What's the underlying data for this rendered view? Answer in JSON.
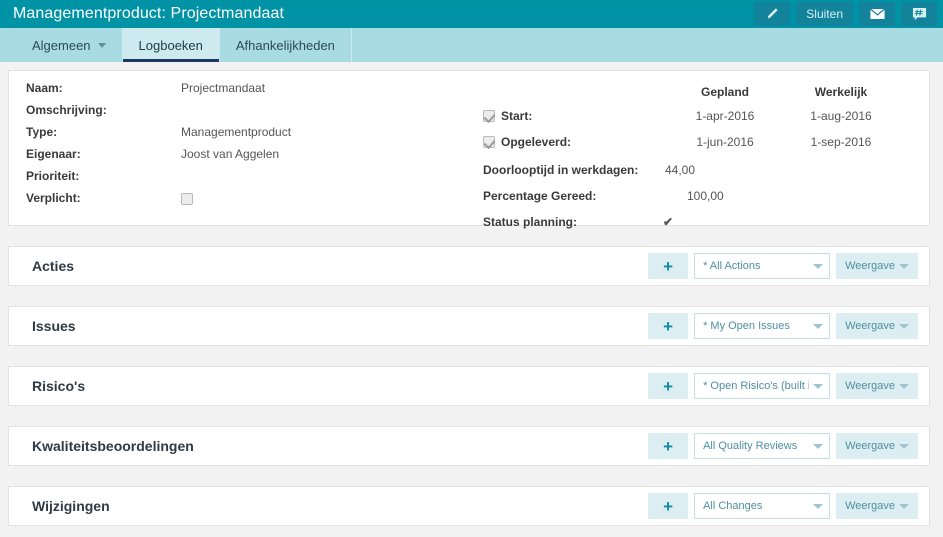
{
  "header": {
    "title": "Managementproduct: Projectmandaat",
    "actions": [
      {
        "name": "edit-button",
        "label": "",
        "icon": "pencil-icon"
      },
      {
        "name": "close-button",
        "label": "Sluiten",
        "icon": ""
      },
      {
        "name": "mail-button",
        "label": "",
        "icon": "envelope-icon"
      },
      {
        "name": "notes-button",
        "label": "",
        "icon": "comment-hash-icon"
      }
    ],
    "accent_color": "#0093a6",
    "button_color": "#12839a"
  },
  "tabs": [
    {
      "label": "Algemeen",
      "active": false,
      "has_caret": true
    },
    {
      "label": "Logboeken",
      "active": true,
      "has_caret": false
    },
    {
      "label": "Afhankelijkheden",
      "active": false,
      "has_caret": false
    }
  ],
  "details": {
    "left_fields": [
      {
        "label": "Naam:",
        "value": "Projectmandaat",
        "type": "text"
      },
      {
        "label": "Omschrijving:",
        "value": "",
        "type": "text"
      },
      {
        "label": "Type:",
        "value": "Managementproduct",
        "type": "text"
      },
      {
        "label": "Eigenaar:",
        "value": "Joost van Aggelen",
        "type": "text"
      },
      {
        "label": "Prioriteit:",
        "value": "",
        "type": "text"
      },
      {
        "label": "Verplicht:",
        "value": "",
        "type": "checkbox",
        "checked": false
      }
    ],
    "column_headers": {
      "planned": "Gepland",
      "actual": "Werkelijk"
    },
    "date_rows": [
      {
        "label": "Start:",
        "checked": true,
        "planned": "1-apr-2016",
        "actual": "1-aug-2016"
      },
      {
        "label": "Opgeleverd:",
        "checked": true,
        "planned": "1-jun-2016",
        "actual": "1-sep-2016"
      }
    ],
    "metrics": [
      {
        "label": "Doorlooptijd in werkdagen:",
        "value": "44,00"
      },
      {
        "label": "Percentage Gereed:",
        "value": "100,00"
      }
    ],
    "status": {
      "label": "Status planning:",
      "value": "✔",
      "color": "#0e8ba0"
    }
  },
  "sections": [
    {
      "title": "Acties",
      "add_label": "+",
      "filter": "* All Actions",
      "view_label": "Weergave"
    },
    {
      "title": "Issues",
      "add_label": "+",
      "filter": "* My Open Issues",
      "view_label": "Weergave"
    },
    {
      "title": "Risico's",
      "add_label": "+",
      "filter": "* Open Risico's (built i",
      "view_label": "Weergave"
    },
    {
      "title": "Kwaliteitsbeoordelingen",
      "add_label": "+",
      "filter": "All Quality Reviews",
      "view_label": "Weergave"
    },
    {
      "title": "Wijzigingen",
      "add_label": "+",
      "filter": "All Changes",
      "view_label": "Weergave"
    }
  ]
}
